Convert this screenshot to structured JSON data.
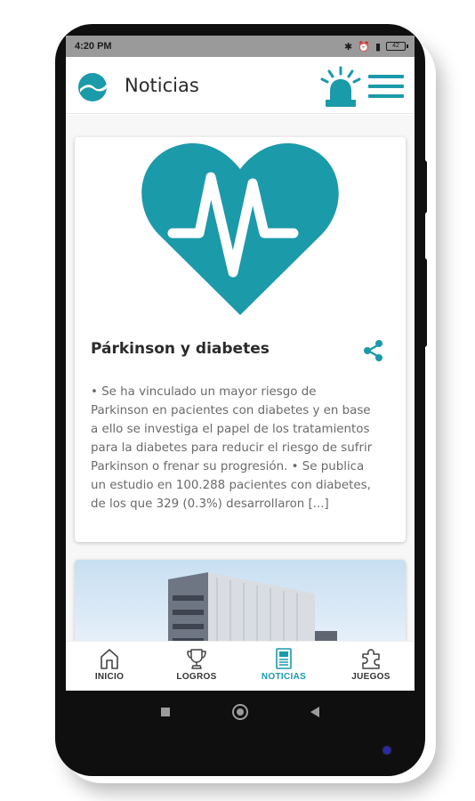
{
  "status_bar": {
    "time": "4:20 PM",
    "icons": [
      "bluetooth-icon",
      "alarm-icon",
      "signal-icon",
      "battery-icon"
    ],
    "battery_level": "42"
  },
  "app_bar": {
    "title": "Noticias",
    "logo_icon": "app-logo-icon",
    "alert_icon": "siren-alert-icon",
    "menu_icon": "hamburger-menu-icon"
  },
  "colors": {
    "accent": "#1b9aaa",
    "text_dark": "#2b2b2b",
    "text_muted": "#6a6a6a"
  },
  "news": [
    {
      "image_icon": "heart-pulse-icon",
      "title": "Párkinson y diabetes",
      "share_icon": "share-icon",
      "lines": [
        "• Se ha vinculado un mayor riesgo de",
        "Parkinson en pacientes con diabetes y en base",
        "a ello se investiga el papel de los tratamientos",
        "para la diabetes para reducir el riesgo de sufrir",
        "Parkinson o frenar su progresión. • Se publica",
        "un estudio en 100.288 pacientes con diabetes,",
        "de los que 329 (0.3%) desarrollaron [...]"
      ]
    },
    {
      "image_icon": "building-photo"
    }
  ],
  "bottom_nav": [
    {
      "label": "INICIO",
      "icon": "home-icon",
      "active": false
    },
    {
      "label": "LOGROS",
      "icon": "trophy-icon",
      "active": false
    },
    {
      "label": "NOTICIAS",
      "icon": "newspaper-icon",
      "active": true
    },
    {
      "label": "JUEGOS",
      "icon": "puzzle-icon",
      "active": false
    }
  ],
  "system_nav": [
    "recent-apps-icon",
    "home-button-icon",
    "back-icon"
  ]
}
